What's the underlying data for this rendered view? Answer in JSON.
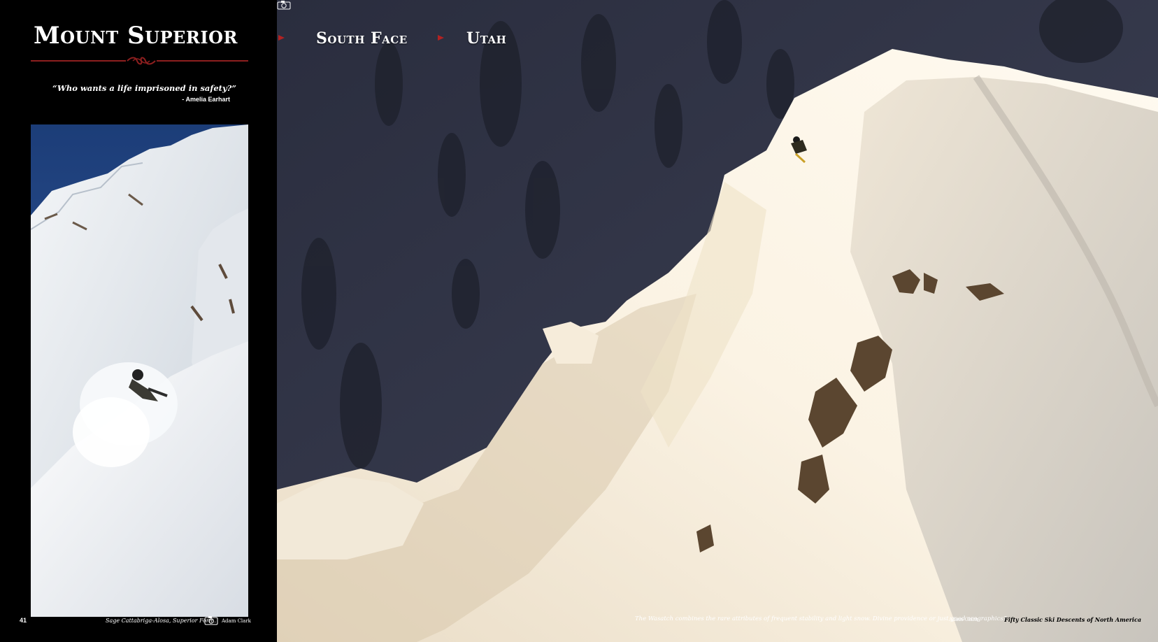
{
  "left_page": {
    "title": "Mount Superior",
    "quote": "“Who wants a life imprisoned in safety?”",
    "quote_attribution": "- Amelia Earhart",
    "page_number": "41",
    "photo_caption": "Sage Cattabriga-Alosa, Superior Form.",
    "photo_credit": "Adam Clark",
    "photo_icon": "camera-icon"
  },
  "right_page": {
    "header_region": "South Face",
    "header_state": "Utah",
    "photo_caption": "The Wasatch combines the rare attributes of frequent stability and light snow. Divine providence or just good orographics?",
    "photo_credit": "Adam Clark",
    "photo_icon": "camera-icon",
    "book_title": "Fifty Classic Ski Descents of North America"
  },
  "colors": {
    "background": "#000000",
    "accent_red": "#b22222",
    "rule_red": "#8e1f1f",
    "snow": "#f5efe3",
    "shadow_slope": "#3a3d4e"
  }
}
